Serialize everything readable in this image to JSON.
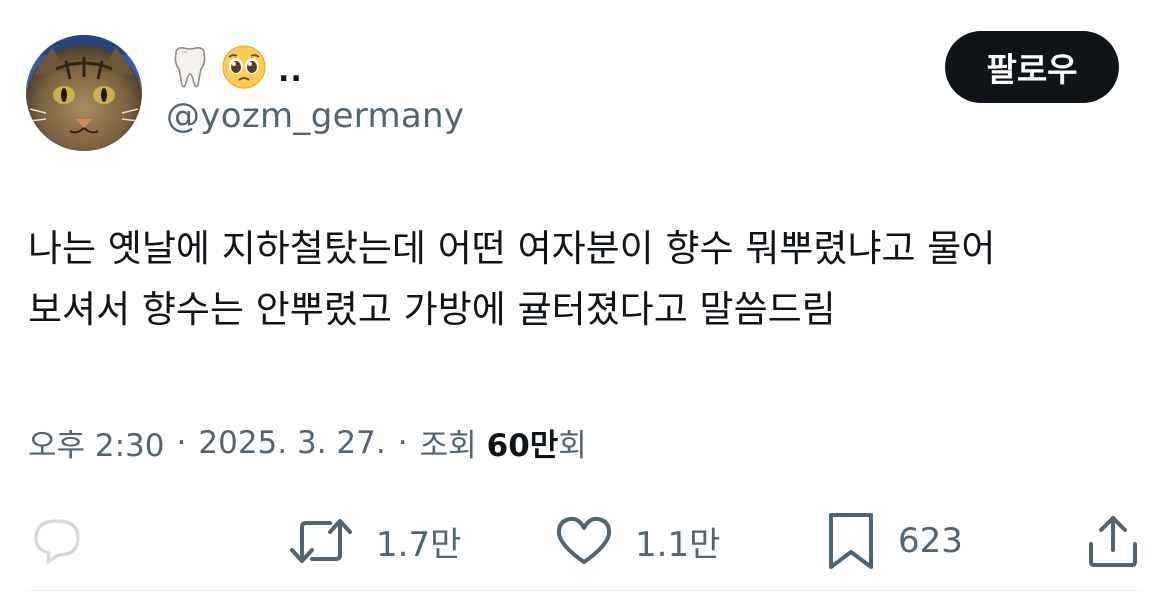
{
  "author": {
    "display_name_emojis": [
      "tooth-emoji",
      "pleading-face-emoji"
    ],
    "display_name_suffix": "..",
    "handle": "@yozm_germany"
  },
  "follow_button": {
    "label": "팔로우"
  },
  "tweet": {
    "text": "나는 옛날에 지하철탔는데 어떤 여자분이 향수 뭐뿌렸냐고 물어\n보셔서 향수는 안뿌렸고 가방에 귤터졌다고 말씀드림"
  },
  "meta": {
    "time": "오후 2:30",
    "separator": "·",
    "date": "2025. 3. 27.",
    "views_label_prefix": "조회",
    "views_number": "60만",
    "views_label_suffix": "회"
  },
  "actions": {
    "reply": {
      "icon": "reply-icon",
      "count": ""
    },
    "retweet": {
      "icon": "retweet-icon",
      "count": "1.7만"
    },
    "like": {
      "icon": "heart-icon",
      "count": "1.1만"
    },
    "bookmark": {
      "icon": "bookmark-icon",
      "count": "623"
    },
    "share": {
      "icon": "share-icon",
      "count": ""
    }
  },
  "colors": {
    "text_primary": "#0f1419",
    "text_secondary": "#536471",
    "button_bg": "#0f1419",
    "button_text": "#ffffff",
    "reply_icon": "#cfd9de"
  }
}
